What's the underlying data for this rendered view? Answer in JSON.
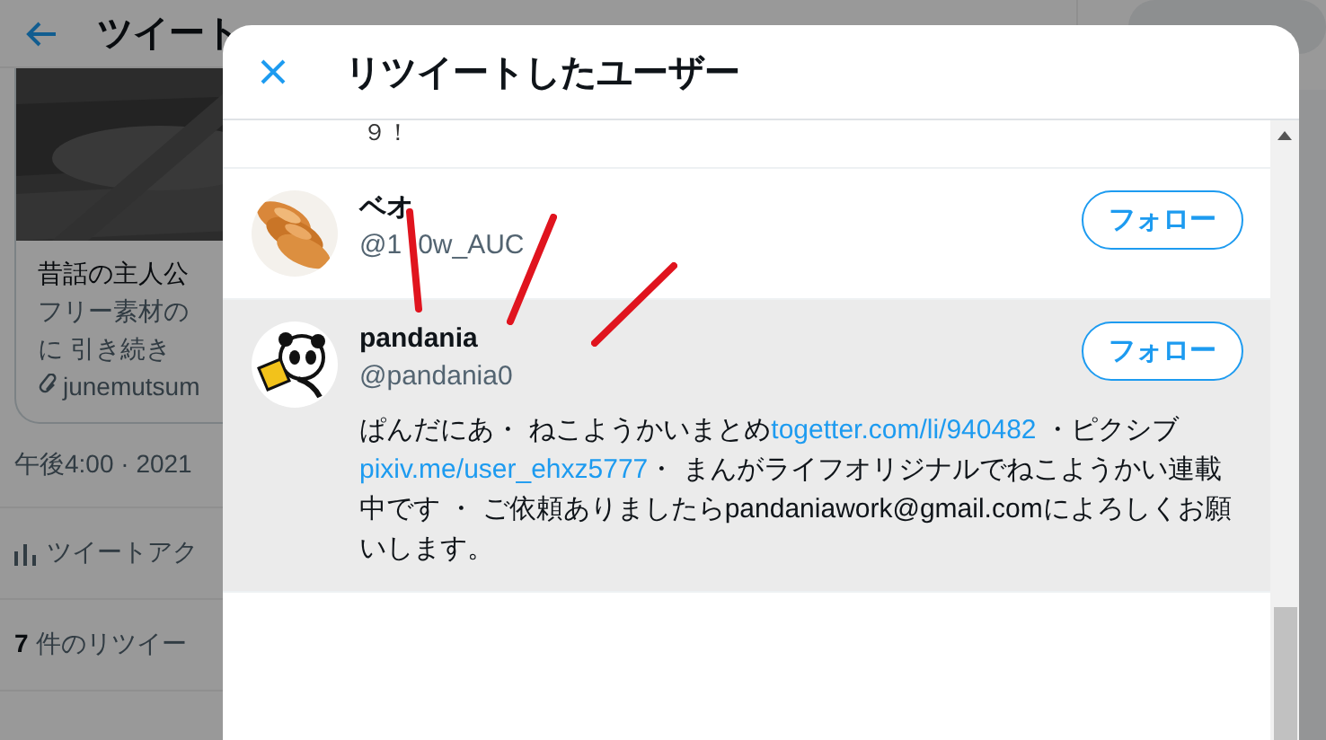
{
  "background": {
    "header": {
      "title": "ツイート"
    },
    "card": {
      "image": {
        "kind": "picture"
      },
      "lines": [
        "昔話の主人公",
        "フリー素材の",
        "に 引き続き"
      ],
      "link": "junemutsum"
    },
    "timestamp": "午後4:00 · 2021",
    "analytics": "ツイートアク",
    "retweets": {
      "count": "7",
      "label": "件のリツイー"
    },
    "search": {
      "kind": "field"
    }
  },
  "modal": {
    "title": "リツイートしたユーザー",
    "partial_text": "９！",
    "users": [
      {
        "name": "ベオ",
        "handle_parts": [
          "@1",
          "0w_AUC"
        ],
        "button": "フォロー",
        "avatar": {
          "kind": "picture"
        },
        "highlighted": false
      },
      {
        "name": "pandania",
        "handle_parts": [
          "@pandania0"
        ],
        "button": "フォロー",
        "avatar": {
          "kind": "icon"
        },
        "highlighted": true,
        "bio": [
          {
            "kind": "text",
            "text": "ぱんだにあ・ ねこようかいまとめ"
          },
          {
            "kind": "link",
            "text": "togetter.com/li/940482"
          },
          {
            "kind": "text",
            "text": " ・ピクシブ"
          },
          {
            "kind": "link",
            "text": "pixiv.me/user_ehxz5777"
          },
          {
            "kind": "text",
            "text": "・ まんがライフオリジナルでねこようかい連載中です ・ ご依頼ありましたらpandaniawork@gmail.comによろしくお願いします。"
          }
        ]
      }
    ]
  }
}
